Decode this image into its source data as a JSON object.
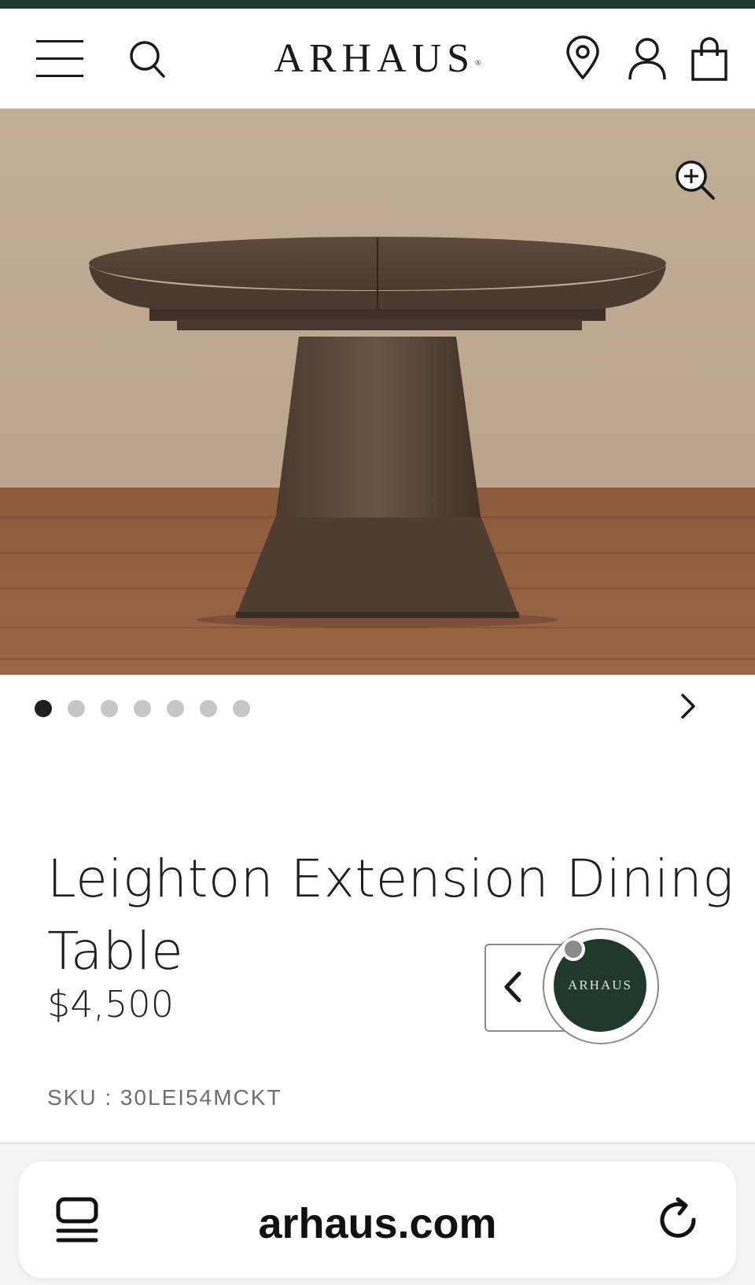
{
  "header": {
    "brand": "ARHAUS",
    "brand_mark": "®",
    "icons": [
      "menu-icon",
      "search-icon",
      "location-pin-icon",
      "account-icon",
      "shopping-bag-icon"
    ],
    "accent_color": "#1f3a2d"
  },
  "gallery": {
    "image_count": 7,
    "active_index": 0,
    "zoom_icon": "zoom-in-icon",
    "next_icon": "chevron-right-icon"
  },
  "product": {
    "title": "Leighton Extension Dining Table",
    "price": "$4,500",
    "sku": "SKU : 30LEI54MCKT"
  },
  "chat_widget": {
    "logo_text": "ARHAUS",
    "collapse_icon": "chevron-left-icon"
  },
  "browser": {
    "url": "arhaus.com",
    "tabs_icon": "tabs-icon",
    "reload_icon": "reload-icon"
  }
}
